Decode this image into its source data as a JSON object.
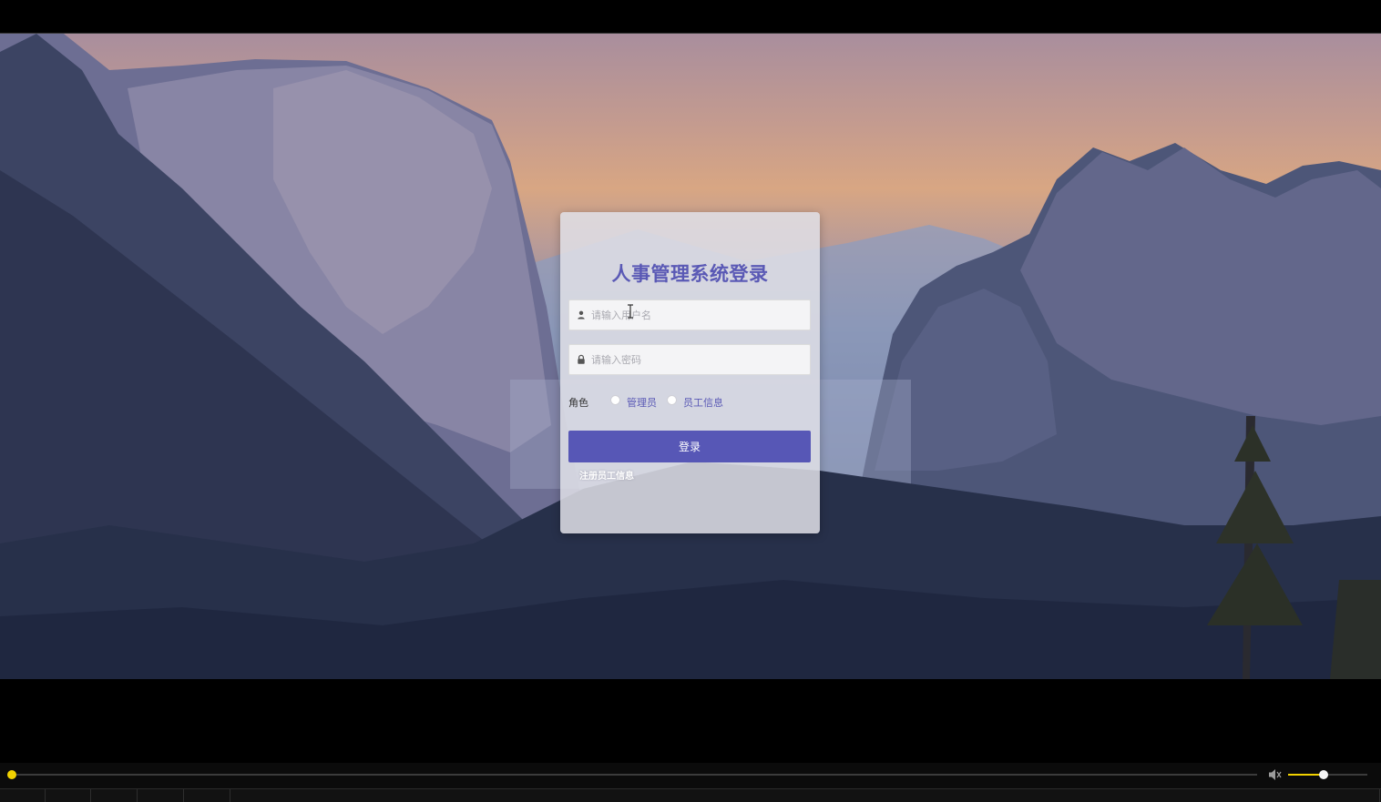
{
  "login": {
    "title": "人事管理系统登录",
    "username_placeholder": "请输入用户名",
    "password_placeholder": "请输入密码",
    "role_label": "角色",
    "roles": [
      "管理员",
      "员工信息"
    ],
    "submit_label": "登录",
    "register_link": "注册员工信息"
  },
  "icons": {
    "username": "user-icon",
    "password": "lock-icon",
    "volume": "speaker-icon"
  },
  "player": {
    "progress_fraction": 0.0,
    "volume_fraction": 0.45
  },
  "colors": {
    "accent": "#5757b6",
    "title": "#5a59b5",
    "seek": "#f2d200"
  }
}
